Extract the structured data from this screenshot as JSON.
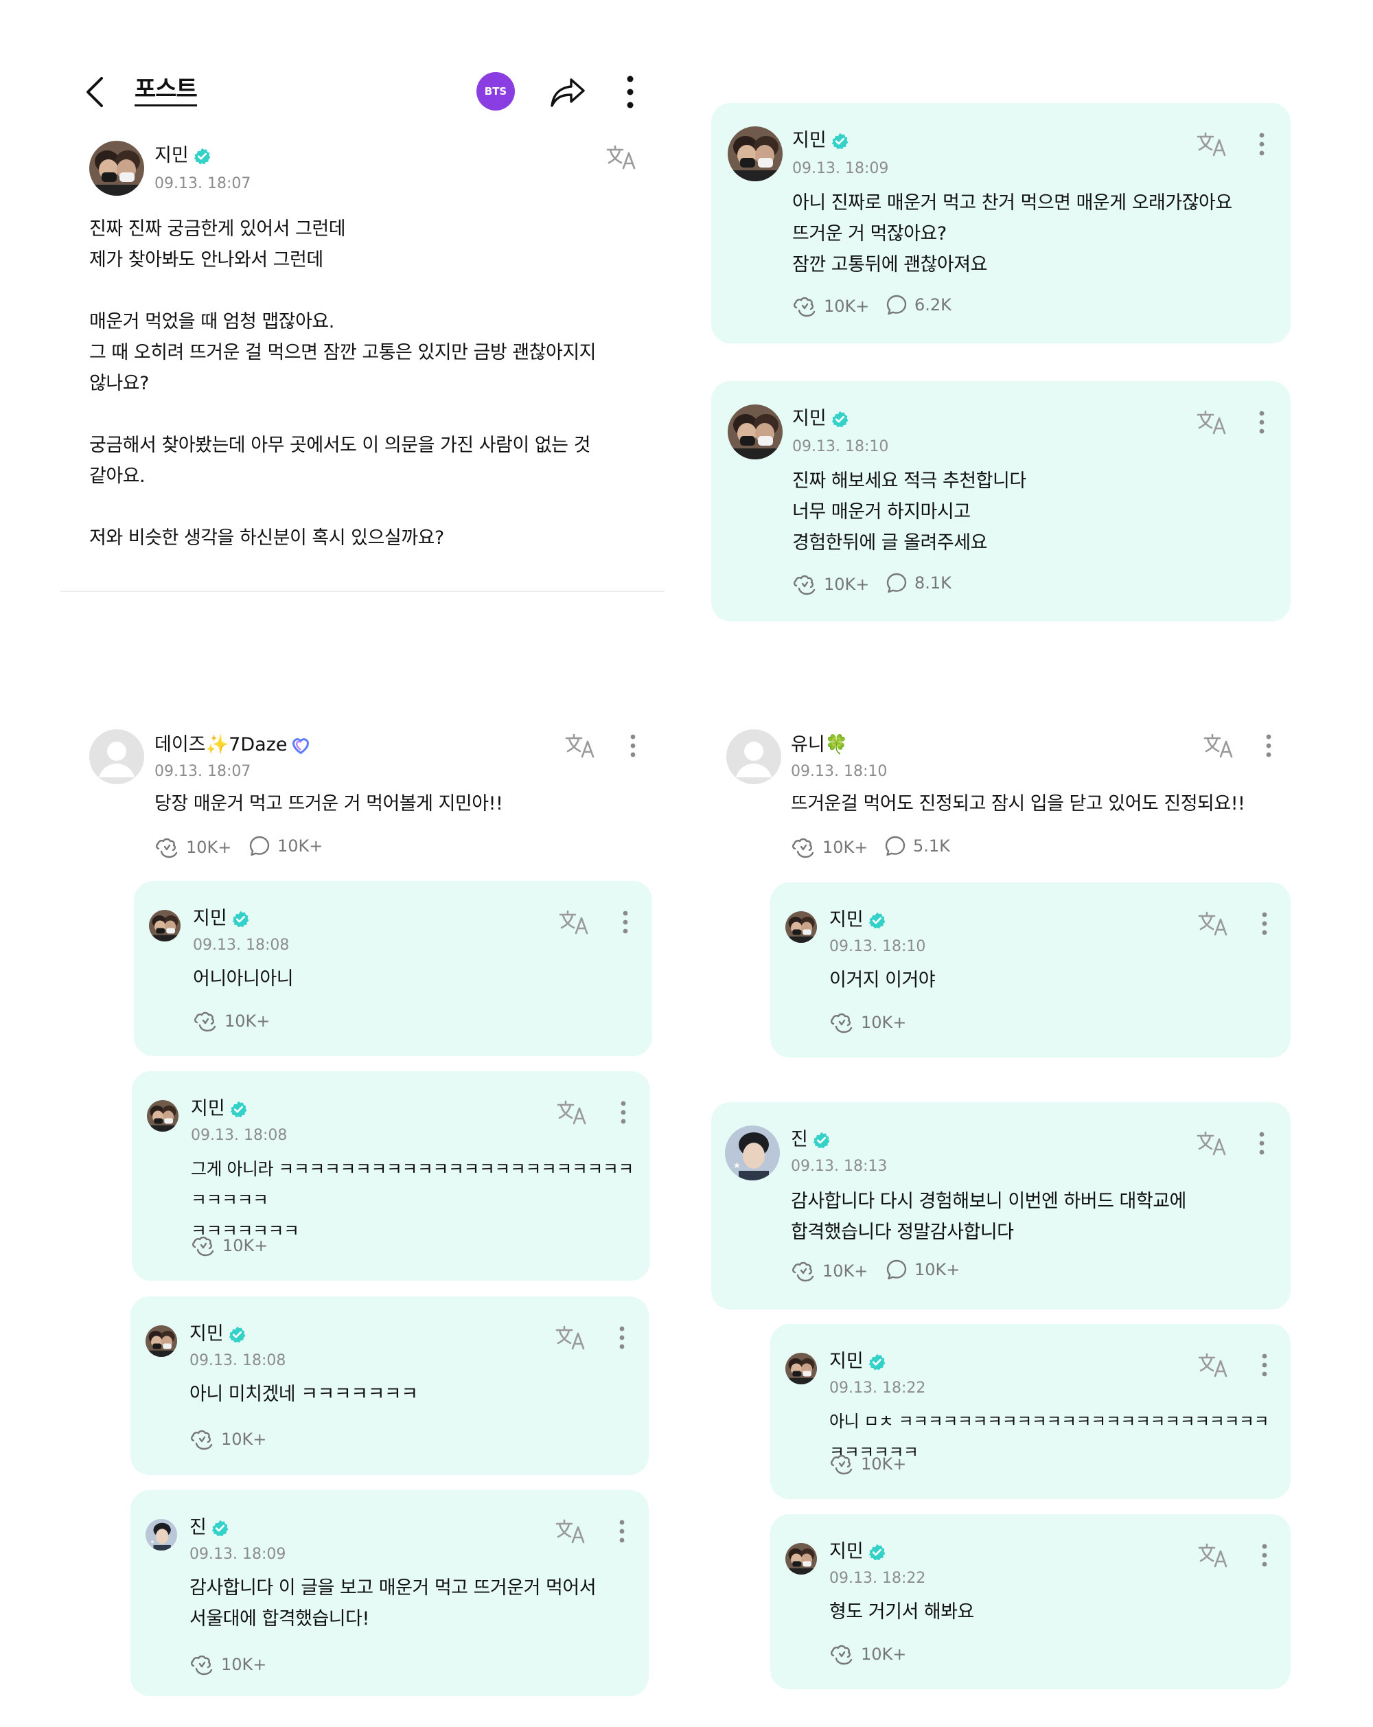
{
  "header": {
    "title": "포스트",
    "badge": "BTS"
  },
  "post": {
    "author": "지민",
    "time": "09.13. 18:07",
    "body": "진짜 진짜 궁금한게 있어서 그런데\n제가 찾아봐도 안나와서 그런데\n\n매운거 먹었을 때 엄청 맵잖아요.\n그 때 오히려 뜨거운 걸 먹으면 잠깐 고통은 있지만 금방 괜찮아지지\n않나요?\n\n궁금해서 찾아봤는데 아무 곳에서도 이 의문을 가진 사람이 없는 것\n같아요.\n\n저와 비슷한 생각을 하신분이 혹시 있으실까요?"
  },
  "cards": [
    {
      "author": "지민",
      "time": "09.13. 18:09",
      "body": "아니 진짜로 매운거 먹고 찬거 먹으면 매운게 오래가잖아요\n뜨거운 거 먹잖아요?\n잠깐 고통뒤에 괜찮아져요",
      "likes": "10K+",
      "comments": "6.2K"
    },
    {
      "author": "지민",
      "time": "09.13. 18:10",
      "body": "진짜 해보세요 적극 추천합니다\n너무 매운거 하지마시고\n경험한뒤에 글 올려주세요",
      "likes": "10K+",
      "comments": "8.1K"
    },
    {
      "author": "데이즈✨7Daze",
      "time": "09.13. 18:07",
      "body": "당장 매운거 먹고 뜨거운 거 먹어볼게 지민아!!",
      "likes": "10K+",
      "comments": "10K+"
    },
    {
      "author": "지민",
      "time": "09.13. 18:08",
      "body": "어니아니아니",
      "likes": "10K+"
    },
    {
      "author": "지민",
      "time": "09.13. 18:08",
      "body": "그게 아니라 ㅋㅋㅋㅋㅋㅋㅋㅋㅋㅋㅋㅋㅋㅋㅋㅋㅋㅋㅋㅋㅋㅋㅋㅋㅋㅋㅋㅋ\nㅋㅋㅋㅋㅋㅋㅋ",
      "likes": "10K+"
    },
    {
      "author": "지민",
      "time": "09.13. 18:08",
      "body": "아니 미치겠네 ㅋㅋㅋㅋㅋㅋㅋ",
      "likes": "10K+"
    },
    {
      "author": "진",
      "time": "09.13. 18:09",
      "body": "감사합니다 이 글을 보고 매운거 먹고 뜨거운거 먹어서\n서울대에 합격했습니다!",
      "likes": "10K+"
    },
    {
      "author": "유니🍀",
      "time": "09.13. 18:10",
      "body": "뜨거운걸 먹어도 진정되고 잠시 입을 닫고 있어도 진정되요!!",
      "likes": "10K+",
      "comments": "5.1K"
    },
    {
      "author": "지민",
      "time": "09.13. 18:10",
      "body": "이거지 이거야",
      "likes": "10K+"
    },
    {
      "author": "진",
      "time": "09.13. 18:13",
      "body": "감사합니다 다시 경험해보니 이번엔 하버드 대학교에\n합격했습니다 정말감사합니다",
      "likes": "10K+",
      "comments": "10K+"
    },
    {
      "author": "지민",
      "time": "09.13. 18:22",
      "body": "아니 ㅁㅊ ㅋㅋㅋㅋㅋㅋㅋㅋㅋㅋㅋㅋㅋㅋㅋㅋㅋㅋㅋㅋㅋㅋㅋㅋㅋㅋㅋㅋㅋㅋㅋ",
      "likes": "10K+"
    },
    {
      "author": "지민",
      "time": "09.13. 18:22",
      "body": "형도 거기서 해봐요",
      "likes": "10K+"
    }
  ],
  "colors": {
    "card_bg": "#e6faf6",
    "verified": "#33d1c8",
    "badge": "#8a3de0"
  }
}
